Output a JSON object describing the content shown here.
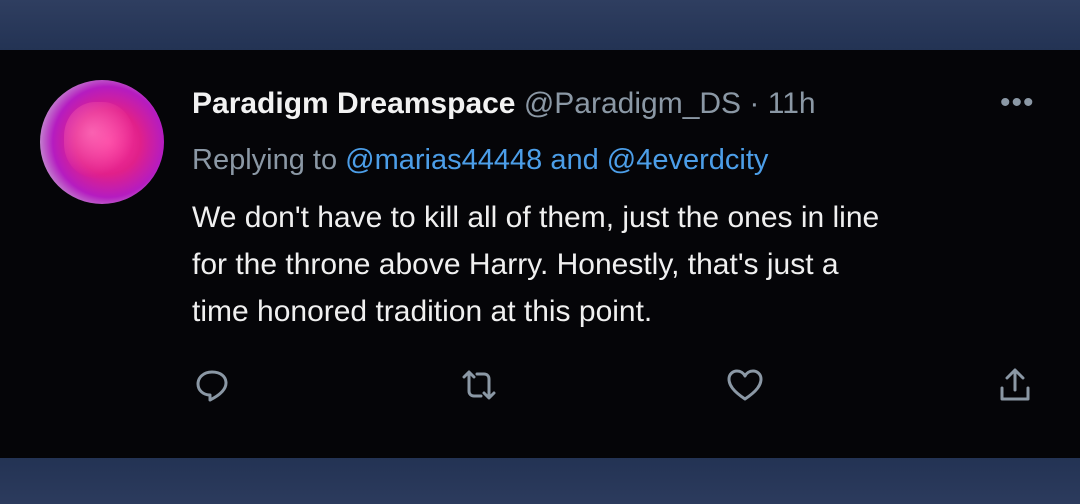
{
  "tweet": {
    "display_name": "Paradigm Dreamspace",
    "handle": "@Paradigm_DS",
    "separator": "·",
    "time": "11h",
    "more_label": "•••",
    "replying_label": "Replying to",
    "mention_1": "@marias44448",
    "and_label": "and",
    "mention_2": "@4everdcity",
    "text_line_1": "We don't have to kill all of them, just the ones in line",
    "text_line_2": "for the throne above Harry. Honestly, that's just a",
    "text_line_3": "time honored tradition at this point."
  },
  "actions": [
    {
      "icon": "reply-icon"
    },
    {
      "icon": "retweet-icon"
    },
    {
      "icon": "like-icon"
    },
    {
      "icon": "share-icon"
    }
  ],
  "colors": {
    "background": "#050508",
    "frame": "#2b3a5c",
    "text_primary": "#f0f0f0",
    "text_secondary": "#8b98a5",
    "link": "#4c9ee8"
  }
}
